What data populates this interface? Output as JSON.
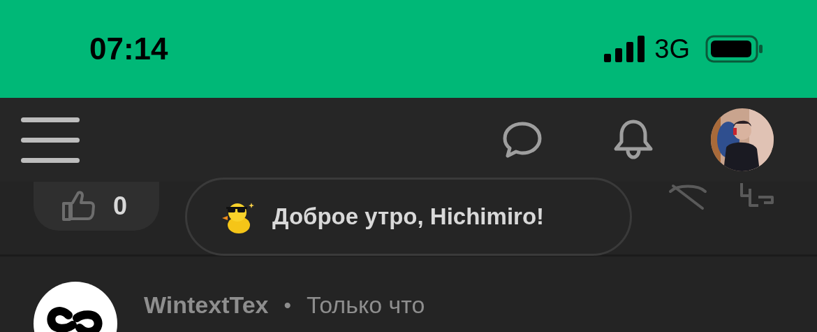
{
  "status_bar": {
    "time": "07:14",
    "network": "3G"
  },
  "post_actions": {
    "like_count": "0"
  },
  "toast": {
    "text": "Доброе утро, Hichimiro!"
  },
  "post": {
    "author": "WintextTex",
    "separator": "•",
    "time": "Только что"
  }
}
